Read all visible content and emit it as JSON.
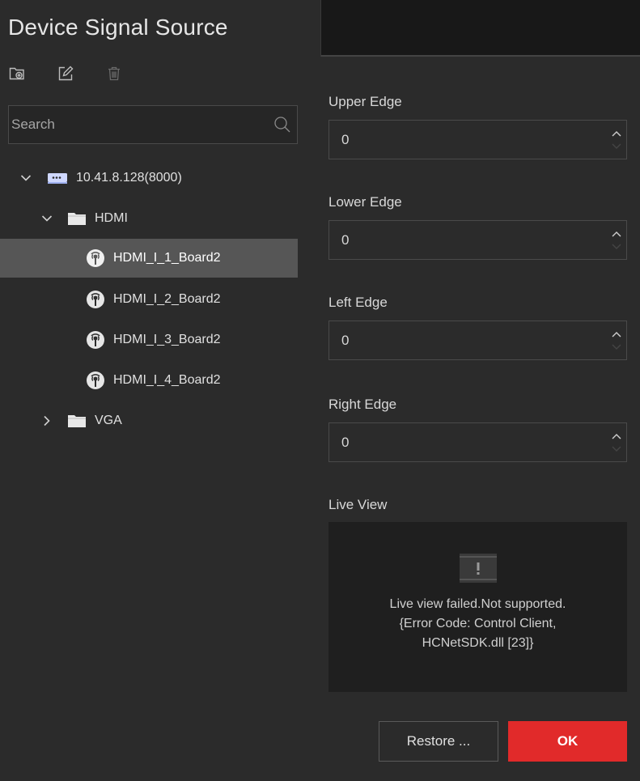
{
  "left_panel": {
    "title": "Device Signal Source",
    "toolbar": {
      "icons": [
        "add-group-icon",
        "edit-icon",
        "delete-icon"
      ]
    },
    "search": {
      "placeholder": "Search"
    },
    "tree": [
      {
        "label": "10.41.8.128(8000)",
        "icon": "device-icon",
        "expanded": true
      },
      {
        "label": "HDMI",
        "icon": "folder-icon",
        "expanded": true
      },
      {
        "label": "HDMI_I_1_Board2",
        "icon": "signal-source-icon",
        "selected": true
      },
      {
        "label": "HDMI_I_2_Board2",
        "icon": "signal-source-icon"
      },
      {
        "label": "HDMI_I_3_Board2",
        "icon": "signal-source-icon"
      },
      {
        "label": "HDMI_I_4_Board2",
        "icon": "signal-source-icon"
      },
      {
        "label": "VGA",
        "icon": "folder-icon",
        "expanded": false
      }
    ]
  },
  "edge_settings": {
    "upper": {
      "label": "Upper Edge",
      "value": "0"
    },
    "lower": {
      "label": "Lower Edge",
      "value": "0"
    },
    "left": {
      "label": "Left Edge",
      "value": "0"
    },
    "right": {
      "label": "Right Edge",
      "value": "0"
    }
  },
  "live_view": {
    "label": "Live View",
    "icon": "video-error-icon",
    "message_line1": "Live view failed.Not supported.",
    "message_line2": "{Error Code: Control Client,",
    "message_line3": "HCNetSDK.dll [23]}"
  },
  "buttons": {
    "restore": "Restore ...",
    "ok": "OK"
  },
  "colors": {
    "accent": "#e12a2a",
    "panel": "#2b2b2b",
    "selected_row": "#565656",
    "text": "#e0e0e0"
  }
}
